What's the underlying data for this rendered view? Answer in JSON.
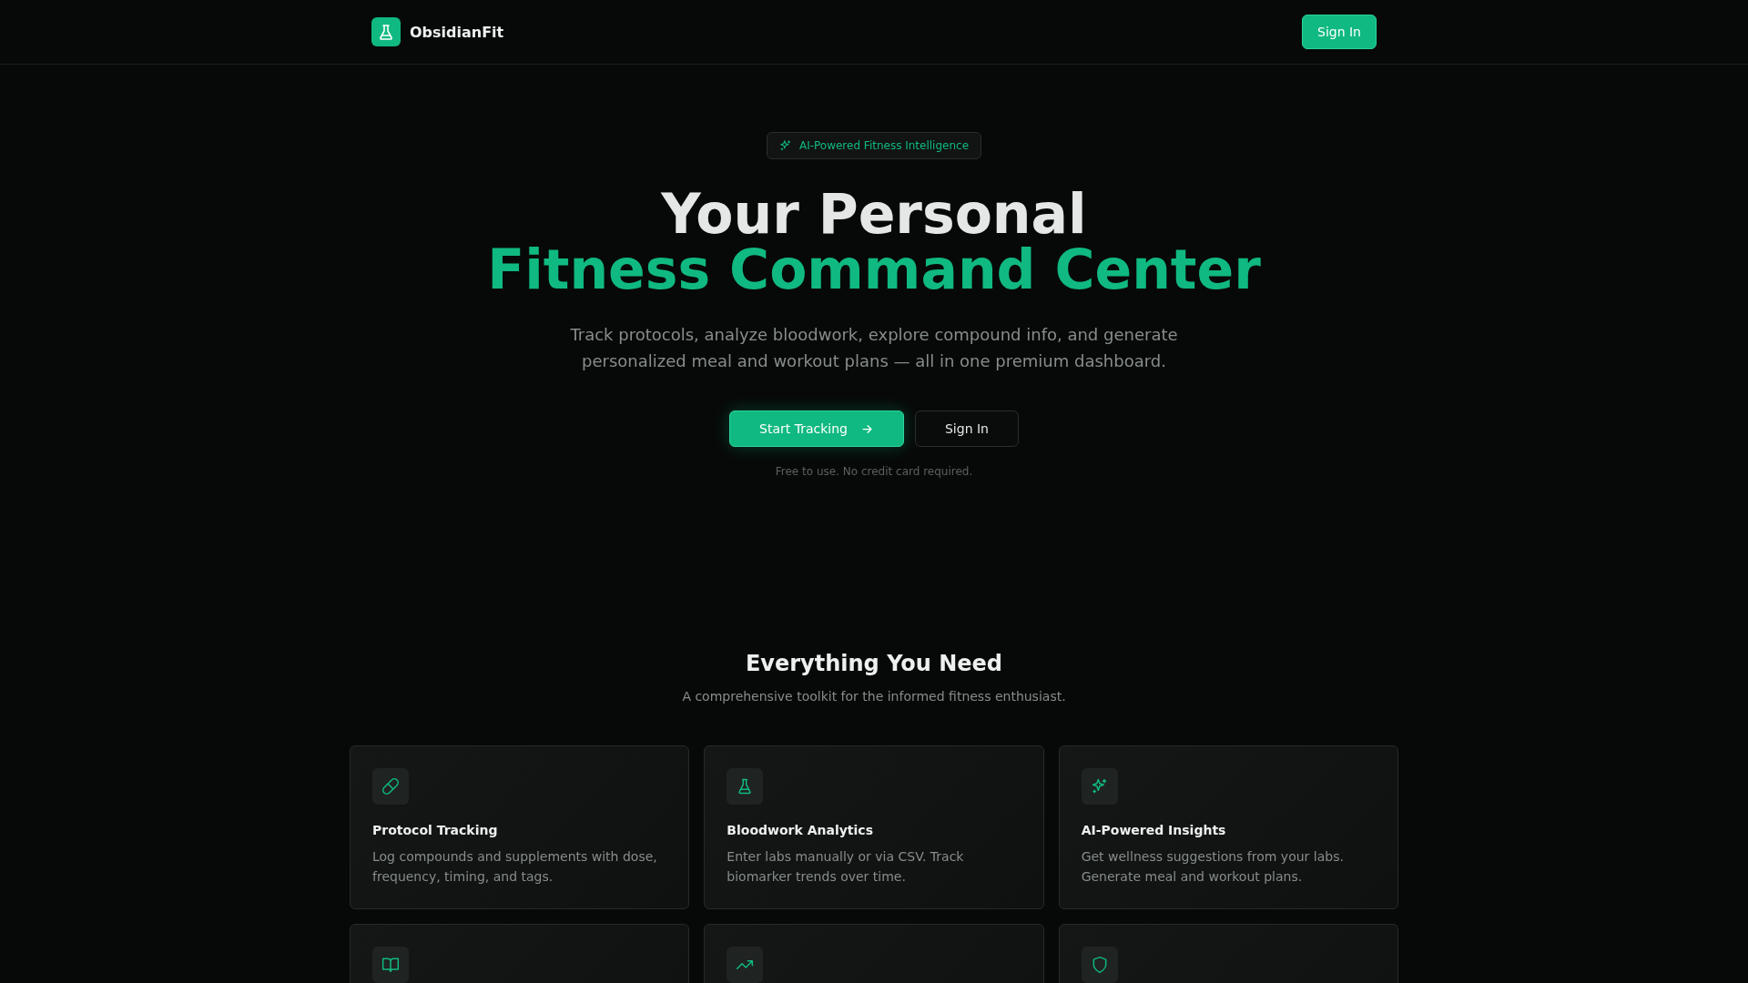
{
  "header": {
    "brand": "ObsidianFit",
    "sign_in": "Sign In"
  },
  "hero": {
    "badge": "AI-Powered Fitness Intelligence",
    "title_line_1": "Your Personal",
    "title_line_2": "Fitness Command Center",
    "subtitle": "Track protocols, analyze bloodwork, explore compound info, and generate personalized meal and workout plans — all in one premium dashboard.",
    "primary_button": "Start Tracking",
    "secondary_button": "Sign In",
    "note": "Free to use. No credit card required."
  },
  "features": {
    "title": "Everything You Need",
    "subtitle": "A comprehensive toolkit for the informed fitness enthusiast.",
    "cards": [
      {
        "kind": "pill",
        "title": "Protocol Tracking",
        "description": "Log compounds and supplements with dose, frequency, timing, and tags."
      },
      {
        "kind": "flask",
        "title": "Bloodwork Analytics",
        "description": "Enter labs manually or via CSV. Track biomarker trends over time."
      },
      {
        "kind": "sparkles",
        "title": "AI-Powered Insights",
        "description": "Get wellness suggestions from your labs. Generate meal and workout plans."
      },
      {
        "kind": "book"
      },
      {
        "kind": "trend"
      },
      {
        "kind": "shield"
      }
    ]
  }
}
